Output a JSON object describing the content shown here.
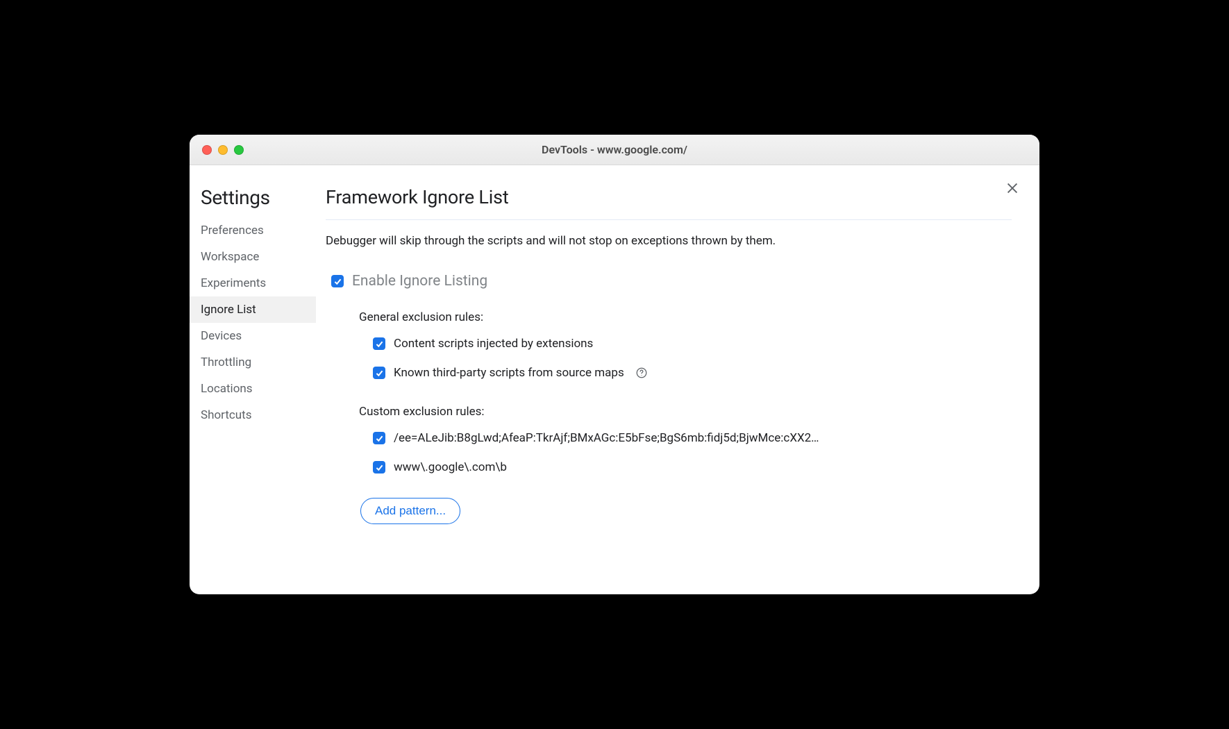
{
  "window": {
    "title": "DevTools - www.google.com/"
  },
  "sidebar": {
    "title": "Settings",
    "items": [
      {
        "label": "Preferences",
        "active": false
      },
      {
        "label": "Workspace",
        "active": false
      },
      {
        "label": "Experiments",
        "active": false
      },
      {
        "label": "Ignore List",
        "active": true
      },
      {
        "label": "Devices",
        "active": false
      },
      {
        "label": "Throttling",
        "active": false
      },
      {
        "label": "Locations",
        "active": false
      },
      {
        "label": "Shortcuts",
        "active": false
      }
    ]
  },
  "main": {
    "heading": "Framework Ignore List",
    "description": "Debugger will skip through the scripts and will not stop on exceptions thrown by them.",
    "enable_label": "Enable Ignore Listing",
    "general_section_label": "General exclusion rules:",
    "general_rules": [
      {
        "label": "Content scripts injected by extensions",
        "has_help": false
      },
      {
        "label": "Known third-party scripts from source maps",
        "has_help": true
      }
    ],
    "custom_section_label": "Custom exclusion rules:",
    "custom_rules": [
      {
        "label": "/ee=ALeJib:B8gLwd;AfeaP:TkrAjf;BMxAGc:E5bFse;BgS6mb:fidj5d;BjwMce:cXX2…"
      },
      {
        "label": "www\\.google\\.com\\b"
      }
    ],
    "add_button_label": "Add pattern..."
  }
}
